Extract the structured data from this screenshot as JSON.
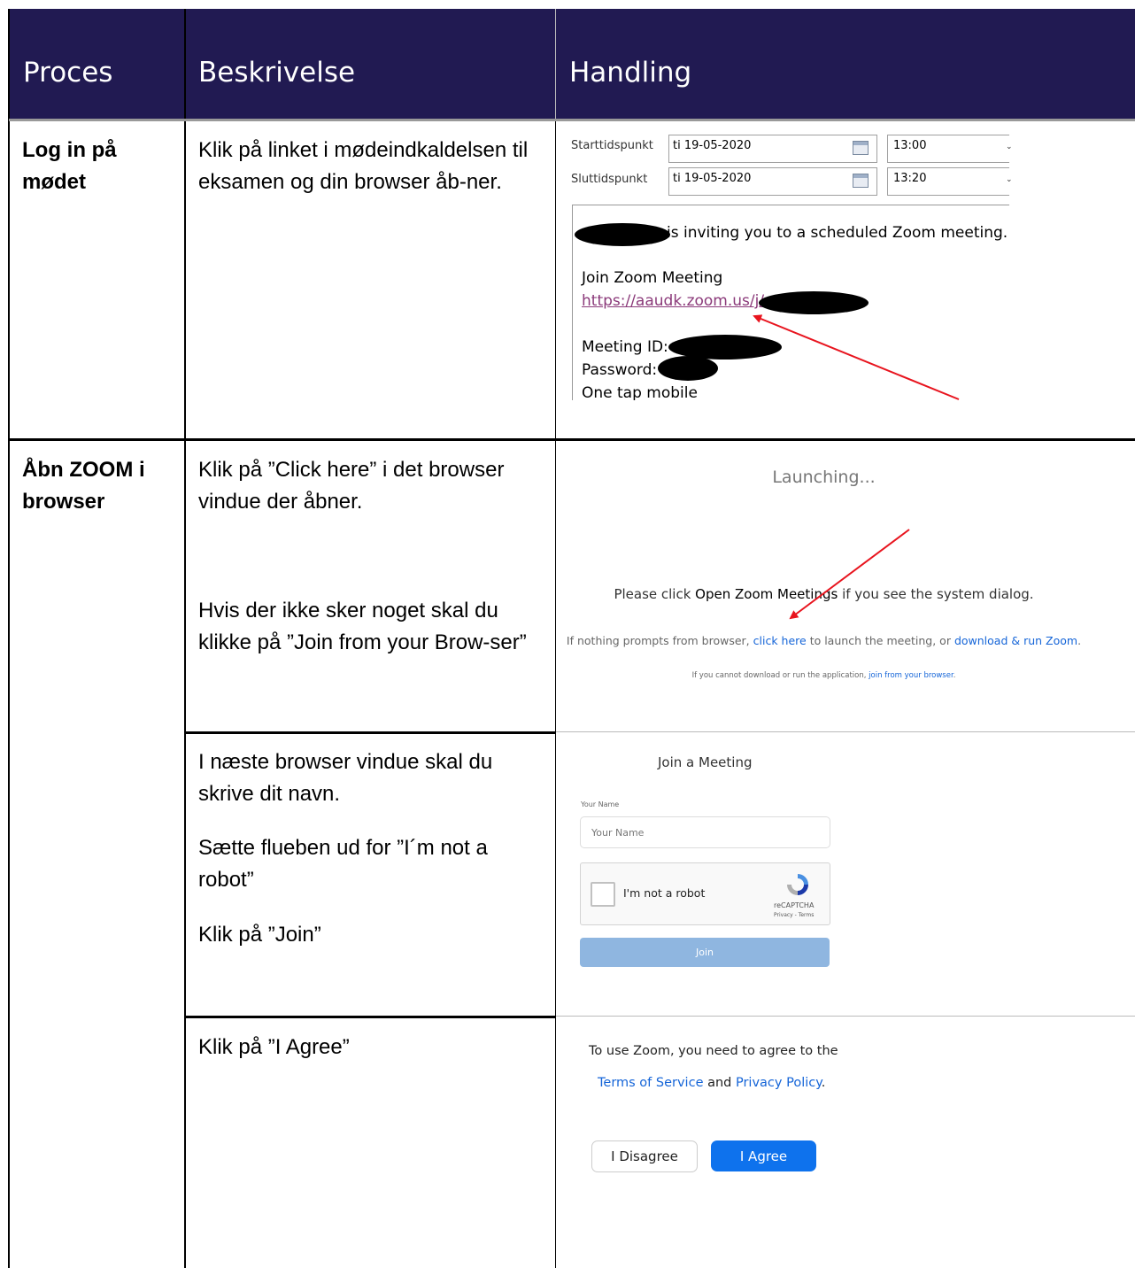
{
  "header": {
    "col1": "Proces",
    "col2": "Beskrivelse",
    "col3": "Handling"
  },
  "row1": {
    "process": "Log in på mødet",
    "description": "Klik på linket i mødeindkaldelsen til eksamen og din browser åb-ner.",
    "calendar": {
      "start_label": "Starttidspunkt",
      "end_label": "Sluttidspunkt",
      "start_date": "ti 19-05-2020",
      "end_date": "ti 19-05-2020",
      "start_time": "13:00",
      "end_time": "13:20"
    },
    "invite": {
      "inviting_text": "is inviting you to a scheduled Zoom meeting.",
      "join_heading": "Join Zoom Meeting",
      "url": "https://aaudk.zoom.us/j/",
      "meeting_id_label": "Meeting ID:",
      "password_label": "Password:",
      "one_tap": "One tap mobile"
    }
  },
  "row2": {
    "process": "Åbn ZOOM i browser",
    "description_1": "Klik på ”Click here” i det browser vindue der åbner.",
    "description_2": "Hvis der ikke sker noget skal du klikke på ”Join from your Brow-ser”",
    "launch": {
      "launching": "Launching...",
      "please_prefix": "Please click ",
      "please_bold": "Open Zoom Meetings",
      "please_suffix": " if you see the system dialog.",
      "nothing_prefix": "If nothing prompts from browser, ",
      "click_here": "click here",
      "nothing_middle": " to launch the meeting, or ",
      "download_run": "download & run Zoom",
      "nothing_suffix": ".",
      "cannot_prefix": "If you cannot download or run the application, ",
      "join_browser": "join from your browser",
      "cannot_suffix": "."
    }
  },
  "row3": {
    "description_1": "I næste browser vindue skal du skrive dit navn.",
    "description_2": "Sætte flueben ud for ”I´m not a robot”",
    "description_3": "Klik på ”Join”",
    "join": {
      "title": "Join a Meeting",
      "name_label": "Your Name",
      "name_placeholder": "Your Name",
      "not_robot": "I'm not a robot",
      "recaptcha": "reCAPTCHA",
      "privacy_terms": "Privacy - Terms",
      "join_button": "Join"
    }
  },
  "row4": {
    "description": "Klik på ”I Agree”",
    "agree": {
      "text_line1": "To use Zoom, you need to agree to the",
      "terms": "Terms of Service",
      "and": " and ",
      "privacy": "Privacy Policy",
      "period": ".",
      "disagree_button": "I Disagree",
      "agree_button": "I Agree"
    }
  },
  "colors": {
    "header_bg": "#211a52",
    "link_blue": "#1565d8",
    "join_button": "#8fb6e0",
    "agree_button": "#0e72ed",
    "arrow_red": "#e8141e"
  }
}
